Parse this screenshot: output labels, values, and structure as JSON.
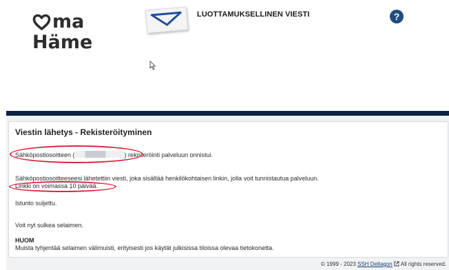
{
  "header": {
    "logo_line1": "ma",
    "logo_line2": "Häme",
    "title": "LUOTTAMUKSELLINEN VIESTI",
    "help_symbol": "?"
  },
  "card": {
    "title": "Viestin lähetys - Rekisteröityminen",
    "registration_prefix": "Sähköpostiosoitteen (",
    "registration_suffix": ") rekisteröinti palveluun onnistui.",
    "sent_info": "Sähköpostiosoitteeseesi lähetettiin viesti, joka sisältää henkilökohtaisen linkin, jolla voit tunnistautua palveluun.",
    "link_valid": "Linkki on voimassa 10 päivää.",
    "session_closed": "Istunto suljettu.",
    "close_browser": "Voit nyt sulkea selaimen.",
    "note_title": "HUOM",
    "note_text": "Muista tyhjentää selaimen välimuisti, erityisesti jos käytät julkisissa tiloissa olevaa tietokonetta."
  },
  "footer": {
    "copyright": "© 1999 - 2023",
    "company_link": "SSH Deltagon",
    "rights": "All rights reserved."
  },
  "colors": {
    "brand_navy": "#0d2344",
    "help_blue": "#1f4e7d",
    "annotation_red": "#d7263d"
  },
  "icons": [
    "heart-logo-icon",
    "envelope-icon",
    "help-icon",
    "cursor-icon",
    "external-link-icon"
  ]
}
